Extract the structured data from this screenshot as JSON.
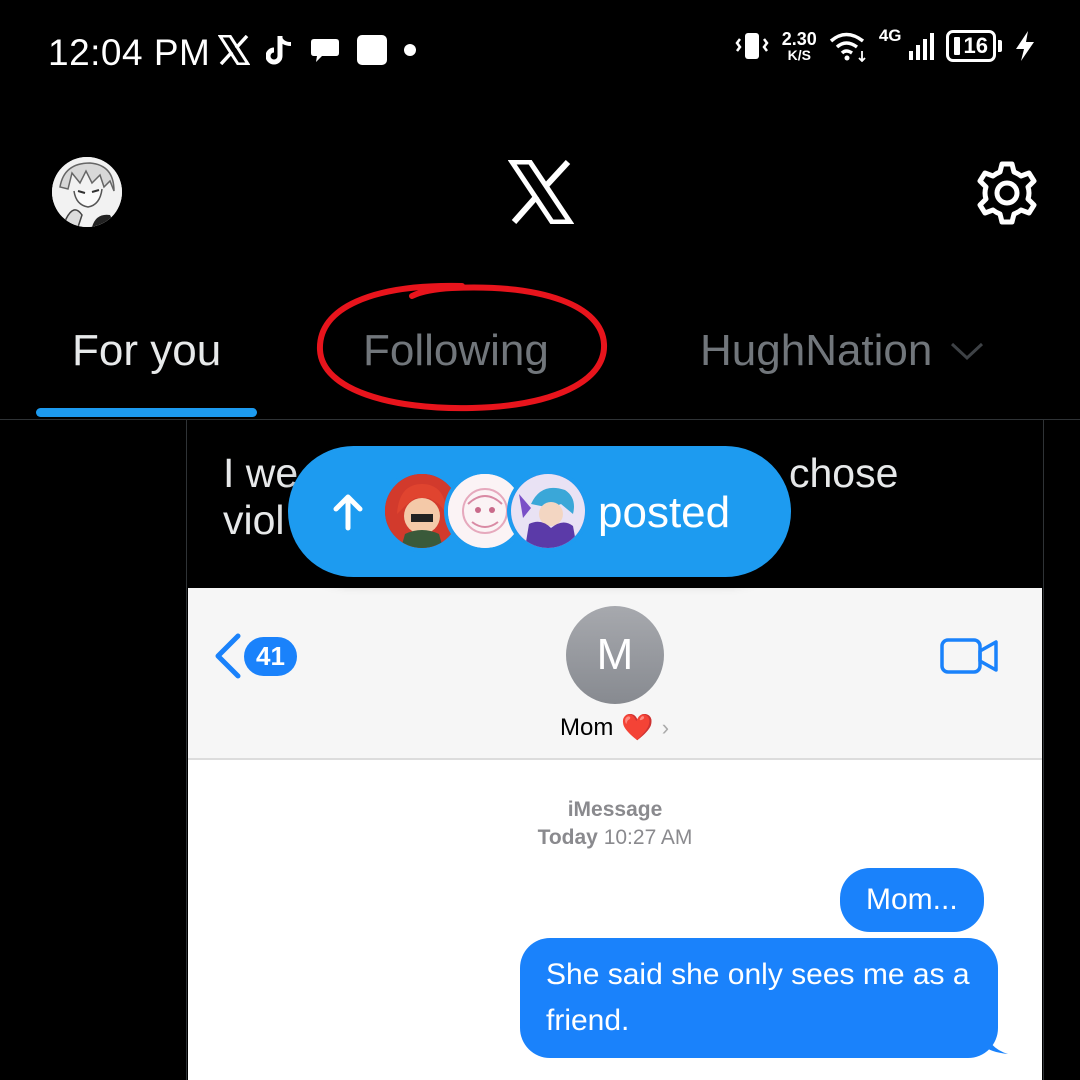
{
  "status_bar": {
    "time": "12:04 PM",
    "left_icons": [
      "x-app-icon",
      "tiktok-icon",
      "chat-bubble-icon",
      "square-icon",
      "dot-icon"
    ],
    "net_speed_value": "2.30",
    "net_speed_unit": "K/S",
    "network": "4G",
    "battery": "16"
  },
  "header": {
    "logo": "X",
    "settings_icon": "gear-icon"
  },
  "tabs": {
    "for_you": "For you",
    "following": "Following",
    "hughnation": "HughNation",
    "active": "For you",
    "accent": "#1d9bf0",
    "annotation_color": "#e8141c"
  },
  "post": {
    "line1_start": "I we",
    "line1_end": "chose",
    "line2_start": "viol"
  },
  "pill": {
    "label": "posted",
    "color": "#1d9bf0"
  },
  "imessage": {
    "back_count": "41",
    "contact_initial": "M",
    "contact_name": "Mom",
    "contact_emoji": "❤️",
    "service": "iMessage",
    "timestamp_day": "Today",
    "timestamp_time": "10:27 AM",
    "messages": [
      "Mom...",
      "She said she only sees me as a friend."
    ],
    "bubble_color": "#1a82fb"
  }
}
